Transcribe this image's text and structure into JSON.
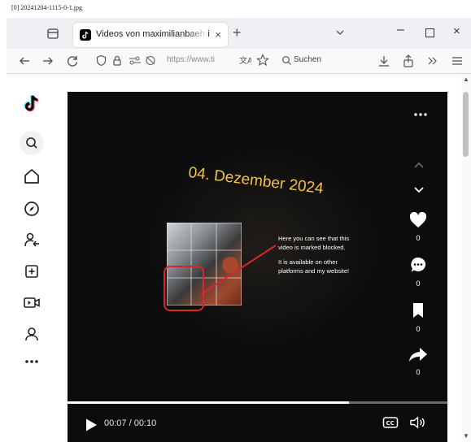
{
  "file_caption": "[0] 20241204-1115-0-1.jpg",
  "tab": {
    "title": "Videos von maximilianbaehring",
    "favicon": "tiktok-icon",
    "close_label": "×"
  },
  "new_tab_label": "+",
  "window": {
    "minimize_label": "–",
    "close_label": "×"
  },
  "navbar": {
    "url": "https://www.ti",
    "search_placeholder": "Suchen"
  },
  "sidebar": {
    "items": [
      {
        "icon": "tiktok-logo"
      },
      {
        "icon": "search-icon"
      },
      {
        "icon": "home-icon"
      },
      {
        "icon": "explore-icon"
      },
      {
        "icon": "following-icon"
      },
      {
        "icon": "upload-icon"
      },
      {
        "icon": "live-icon"
      },
      {
        "icon": "profile-icon"
      },
      {
        "icon": "more-icon"
      }
    ]
  },
  "video": {
    "date_overlay": "04. Dezember 2024",
    "caption_line1": "Here you can see that this video is marked blocked.",
    "caption_line2": "It is available on other platforms and my website!",
    "progress": 0.74,
    "time": "00:07 / 00:10",
    "actions": {
      "likes": "0",
      "comments": "0",
      "saves": "0",
      "shares": "0"
    }
  },
  "colors": {
    "accent_date": "#f2c24a",
    "highlight_circle": "#d9262b",
    "video_bg": "#0c0c0c"
  }
}
